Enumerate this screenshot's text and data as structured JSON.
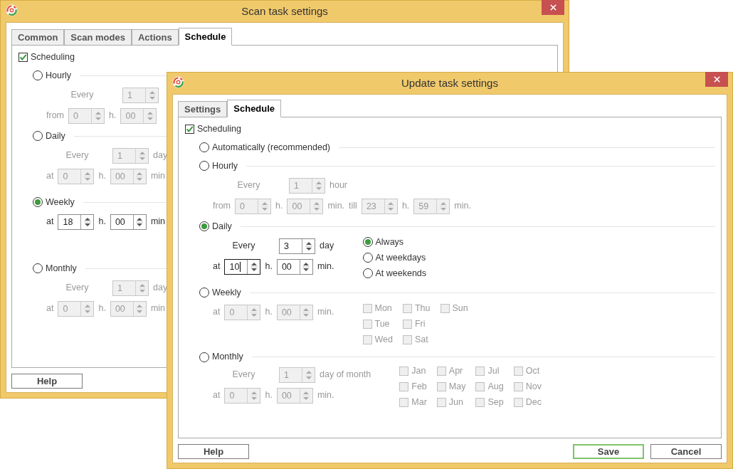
{
  "windows": [
    {
      "title": "Scan task settings",
      "tabs": [
        {
          "label": "Common",
          "selected": false
        },
        {
          "label": "Scan modes",
          "selected": false
        },
        {
          "label": "Actions",
          "selected": false
        },
        {
          "label": "Schedule",
          "selected": true
        }
      ],
      "scheduling": {
        "label": "Scheduling",
        "checked": true
      },
      "sections": [
        {
          "kind": "hourly",
          "label": "Hourly",
          "selected": false,
          "rows": [
            {
              "kind": "every",
              "items": [
                {
                  "kind": "label",
                  "text": "Every"
                },
                {
                  "kind": "spin",
                  "value": "1",
                  "focused": false
                }
              ]
            },
            {
              "kind": "time",
              "items": [
                {
                  "kind": "label",
                  "text": "from"
                },
                {
                  "kind": "spin",
                  "value": "0",
                  "focused": false
                },
                {
                  "kind": "label",
                  "text": "h."
                },
                {
                  "kind": "spin",
                  "value": "00",
                  "focused": false
                }
              ]
            }
          ]
        },
        {
          "kind": "daily",
          "label": "Daily",
          "selected": false,
          "rows": [
            {
              "kind": "every",
              "items": [
                {
                  "kind": "label",
                  "text": "Every"
                },
                {
                  "kind": "spin",
                  "value": "1",
                  "focused": false
                },
                {
                  "kind": "label",
                  "text": "day"
                }
              ]
            },
            {
              "kind": "time",
              "items": [
                {
                  "kind": "label",
                  "text": "at"
                },
                {
                  "kind": "spin",
                  "value": "0",
                  "focused": false
                },
                {
                  "kind": "label",
                  "text": "h."
                },
                {
                  "kind": "spin",
                  "value": "00",
                  "focused": false
                },
                {
                  "kind": "label",
                  "text": "min"
                }
              ]
            }
          ]
        },
        {
          "kind": "weekly",
          "label": "Weekly",
          "selected": true,
          "rows": [
            {
              "kind": "time",
              "items": [
                {
                  "kind": "label",
                  "text": "at"
                },
                {
                  "kind": "spin",
                  "value": "18",
                  "focused": false
                },
                {
                  "kind": "label",
                  "text": "h."
                },
                {
                  "kind": "spin",
                  "value": "00",
                  "focused": false
                },
                {
                  "kind": "label",
                  "text": "min"
                }
              ]
            }
          ]
        },
        {
          "kind": "monthly",
          "label": "Monthly",
          "selected": false,
          "rows": [
            {
              "kind": "every",
              "items": [
                {
                  "kind": "label",
                  "text": "Every"
                },
                {
                  "kind": "spin",
                  "value": "1",
                  "focused": false
                },
                {
                  "kind": "label",
                  "text": "day"
                }
              ]
            },
            {
              "kind": "time",
              "items": [
                {
                  "kind": "label",
                  "text": "at"
                },
                {
                  "kind": "spin",
                  "value": "0",
                  "focused": false
                },
                {
                  "kind": "label",
                  "text": "h."
                },
                {
                  "kind": "spin",
                  "value": "00",
                  "focused": false
                },
                {
                  "kind": "label",
                  "text": "min"
                }
              ]
            }
          ]
        }
      ],
      "buttons": [
        {
          "label": "Help",
          "kind": "help"
        }
      ]
    },
    {
      "title": "Update task settings",
      "tabs": [
        {
          "label": "Settings",
          "selected": false
        },
        {
          "label": "Schedule",
          "selected": true
        }
      ],
      "scheduling": {
        "label": "Scheduling",
        "checked": true
      },
      "sections": [
        {
          "kind": "auto",
          "label": "Automatically (recommended)",
          "selected": false
        },
        {
          "kind": "hourly",
          "label": "Hourly",
          "selected": false,
          "rows": [
            {
              "kind": "every",
              "items": [
                {
                  "kind": "label",
                  "text": "Every"
                },
                {
                  "kind": "spin",
                  "value": "1",
                  "focused": false
                },
                {
                  "kind": "label",
                  "text": "hour"
                }
              ]
            },
            {
              "kind": "time",
              "items": [
                {
                  "kind": "label",
                  "text": "from"
                },
                {
                  "kind": "spin",
                  "value": "0",
                  "focused": false
                },
                {
                  "kind": "label",
                  "text": "h."
                },
                {
                  "kind": "spin",
                  "value": "00",
                  "focused": false
                },
                {
                  "kind": "label",
                  "text": "min."
                },
                {
                  "kind": "label",
                  "text": "till"
                },
                {
                  "kind": "spin",
                  "value": "23",
                  "focused": false
                },
                {
                  "kind": "label",
                  "text": "h."
                },
                {
                  "kind": "spin",
                  "value": "59",
                  "focused": false
                },
                {
                  "kind": "label",
                  "text": "min."
                }
              ]
            }
          ]
        },
        {
          "kind": "daily",
          "label": "Daily",
          "selected": true,
          "rows": [
            {
              "kind": "every",
              "items": [
                {
                  "kind": "label",
                  "text": "Every"
                },
                {
                  "kind": "spin",
                  "value": "3",
                  "focused": false
                },
                {
                  "kind": "label",
                  "text": "day"
                }
              ]
            },
            {
              "kind": "time",
              "items": [
                {
                  "kind": "label",
                  "text": "at"
                },
                {
                  "kind": "spin",
                  "value": "10",
                  "focused": true
                },
                {
                  "kind": "label",
                  "text": "h."
                },
                {
                  "kind": "spin",
                  "value": "00",
                  "focused": false
                },
                {
                  "kind": "label",
                  "text": "min."
                }
              ]
            }
          ],
          "side": {
            "kind": "radios",
            "columns": [
              [
                {
                  "label": "Always",
                  "selected": true
                },
                {
                  "label": "At weekdays",
                  "selected": false
                },
                {
                  "label": "At weekends",
                  "selected": false
                }
              ]
            ]
          }
        },
        {
          "kind": "weekly",
          "label": "Weekly",
          "selected": false,
          "rows": [
            {
              "kind": "time",
              "items": [
                {
                  "kind": "label",
                  "text": "at"
                },
                {
                  "kind": "spin",
                  "value": "0",
                  "focused": false
                },
                {
                  "kind": "label",
                  "text": "h."
                },
                {
                  "kind": "spin",
                  "value": "00",
                  "focused": false
                },
                {
                  "kind": "label",
                  "text": "min."
                }
              ]
            }
          ],
          "side": {
            "kind": "checks",
            "columns": [
              [
                {
                  "label": "Mon",
                  "checked": false
                },
                {
                  "label": "Tue",
                  "checked": false
                },
                {
                  "label": "Wed",
                  "checked": false
                }
              ],
              [
                {
                  "label": "Thu",
                  "checked": false
                },
                {
                  "label": "Fri",
                  "checked": false
                },
                {
                  "label": "Sat",
                  "checked": false
                }
              ],
              [
                {
                  "label": "Sun",
                  "checked": false
                }
              ]
            ]
          }
        },
        {
          "kind": "monthly",
          "label": "Monthly",
          "selected": false,
          "rows": [
            {
              "kind": "every",
              "items": [
                {
                  "kind": "label",
                  "text": "Every"
                },
                {
                  "kind": "spin",
                  "value": "1",
                  "focused": false
                },
                {
                  "kind": "label",
                  "text": "day of month"
                }
              ]
            },
            {
              "kind": "time",
              "items": [
                {
                  "kind": "label",
                  "text": "at"
                },
                {
                  "kind": "spin",
                  "value": "0",
                  "focused": false
                },
                {
                  "kind": "label",
                  "text": "h."
                },
                {
                  "kind": "spin",
                  "value": "00",
                  "focused": false
                },
                {
                  "kind": "label",
                  "text": "min."
                }
              ]
            }
          ],
          "side": {
            "kind": "checks",
            "columns": [
              [
                {
                  "label": "Jan",
                  "checked": false
                },
                {
                  "label": "Feb",
                  "checked": false
                },
                {
                  "label": "Mar",
                  "checked": false
                }
              ],
              [
                {
                  "label": "Apr",
                  "checked": false
                },
                {
                  "label": "May",
                  "checked": false
                },
                {
                  "label": "Jun",
                  "checked": false
                }
              ],
              [
                {
                  "label": "Jul",
                  "checked": false
                },
                {
                  "label": "Aug",
                  "checked": false
                },
                {
                  "label": "Sep",
                  "checked": false
                }
              ],
              [
                {
                  "label": "Oct",
                  "checked": false
                },
                {
                  "label": "Nov",
                  "checked": false
                },
                {
                  "label": "Dec",
                  "checked": false
                }
              ]
            ]
          }
        }
      ],
      "buttons": [
        {
          "label": "Help",
          "kind": "help"
        },
        {
          "label": "Save",
          "kind": "default"
        },
        {
          "label": "Cancel",
          "kind": "normal"
        }
      ]
    }
  ]
}
